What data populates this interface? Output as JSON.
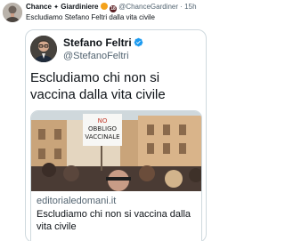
{
  "retweet": {
    "author_name": "Chance",
    "author_name_suffix": "Giardiniere",
    "handle": "@ChanceGardiner",
    "separator": "·",
    "time": "15h",
    "badge_text": "18",
    "text": "Escludiamo Stefano Feltri dalla vita civile"
  },
  "quoted": {
    "author_name": "Stefano Feltri",
    "handle": "@StefanoFeltri",
    "text": "Escludiamo chi non si vaccina dalla vita civile",
    "verified_color": "#1d9bf0"
  },
  "link_card": {
    "domain": "editorialedomani.it",
    "title": "Escludiamo chi non si vaccina dalla vita civile",
    "image_sign_text_1": "NO",
    "image_sign_text_2": "OBBLIGO",
    "image_sign_text_3": "VACCINALE"
  },
  "colors": {
    "text": "#0f1419",
    "muted": "#536471",
    "border": "#cfd9de"
  }
}
